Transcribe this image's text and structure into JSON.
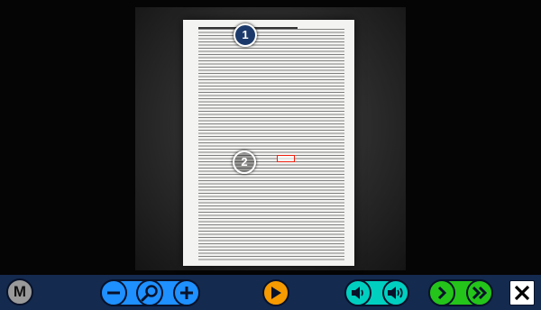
{
  "markers": {
    "first": "1",
    "second": "2"
  },
  "toolbar": {
    "menu_label": "M",
    "icons": [
      "menu-icon",
      "zoom-out-icon",
      "zoom-icon",
      "zoom-in-icon",
      "play-icon",
      "volume-down-icon",
      "volume-up-icon",
      "speed-down-icon",
      "speed-up-icon",
      "close-icon"
    ],
    "colors": {
      "bar": "#142a4f",
      "grey": "#9a9a9a",
      "blue": "#1e90ff",
      "orange": "#f59a00",
      "teal": "#00cfc0",
      "green": "#24c41a",
      "white": "#ffffff"
    }
  }
}
